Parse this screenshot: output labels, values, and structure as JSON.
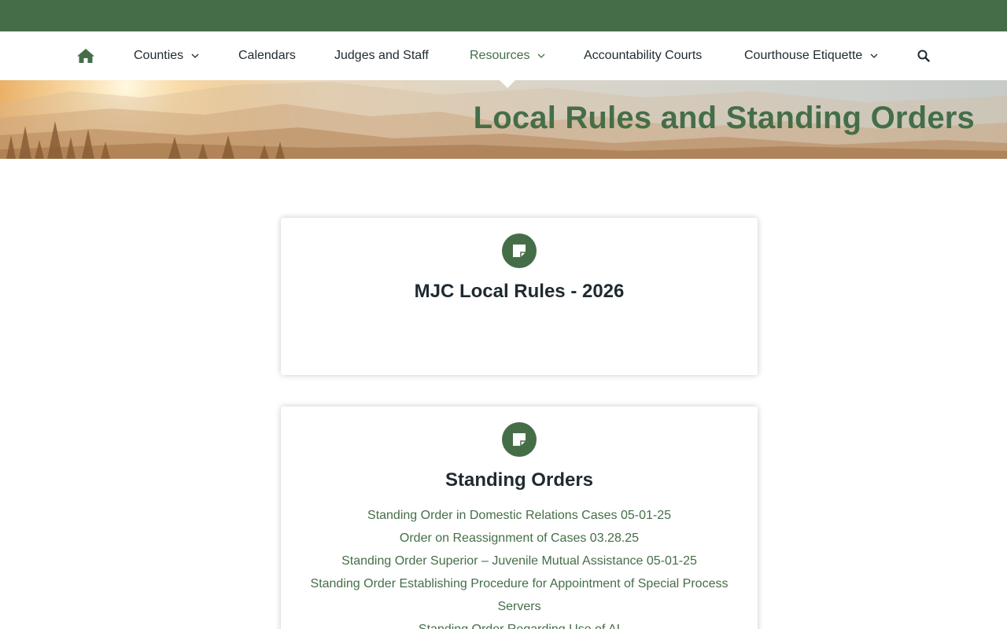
{
  "colors": {
    "brand_green": "#456e48",
    "text_dark": "#1f2a30",
    "background": "#ffffff"
  },
  "nav": {
    "home_icon": "home-icon",
    "items": [
      {
        "label": "Counties",
        "has_dropdown": true
      },
      {
        "label": "Calendars",
        "has_dropdown": false
      },
      {
        "label": "Judges and Staff",
        "has_dropdown": false
      },
      {
        "label": "Resources",
        "has_dropdown": true,
        "active": true
      },
      {
        "label": "Accountability Courts",
        "has_dropdown": false
      },
      {
        "label": "Courthouse Etiquette",
        "has_dropdown": true
      }
    ],
    "search_icon": "search-icon"
  },
  "hero": {
    "title": "Local Rules and Standing Orders"
  },
  "cards": [
    {
      "icon": "sticky-note-icon",
      "title": "MJC Local Rules - 2026",
      "links": []
    },
    {
      "icon": "sticky-note-icon",
      "title": "Standing Orders",
      "links": [
        "Standing Order in Domestic Relations Cases 05-01-25",
        "Order on Reassignment of Cases 03.28.25",
        "Standing Order Superior – Juvenile Mutual Assistance 05-01-25",
        "Standing Order Establishing Procedure for Appointment of Special Process Servers",
        "Standing Order Regarding Use of AI"
      ]
    }
  ]
}
